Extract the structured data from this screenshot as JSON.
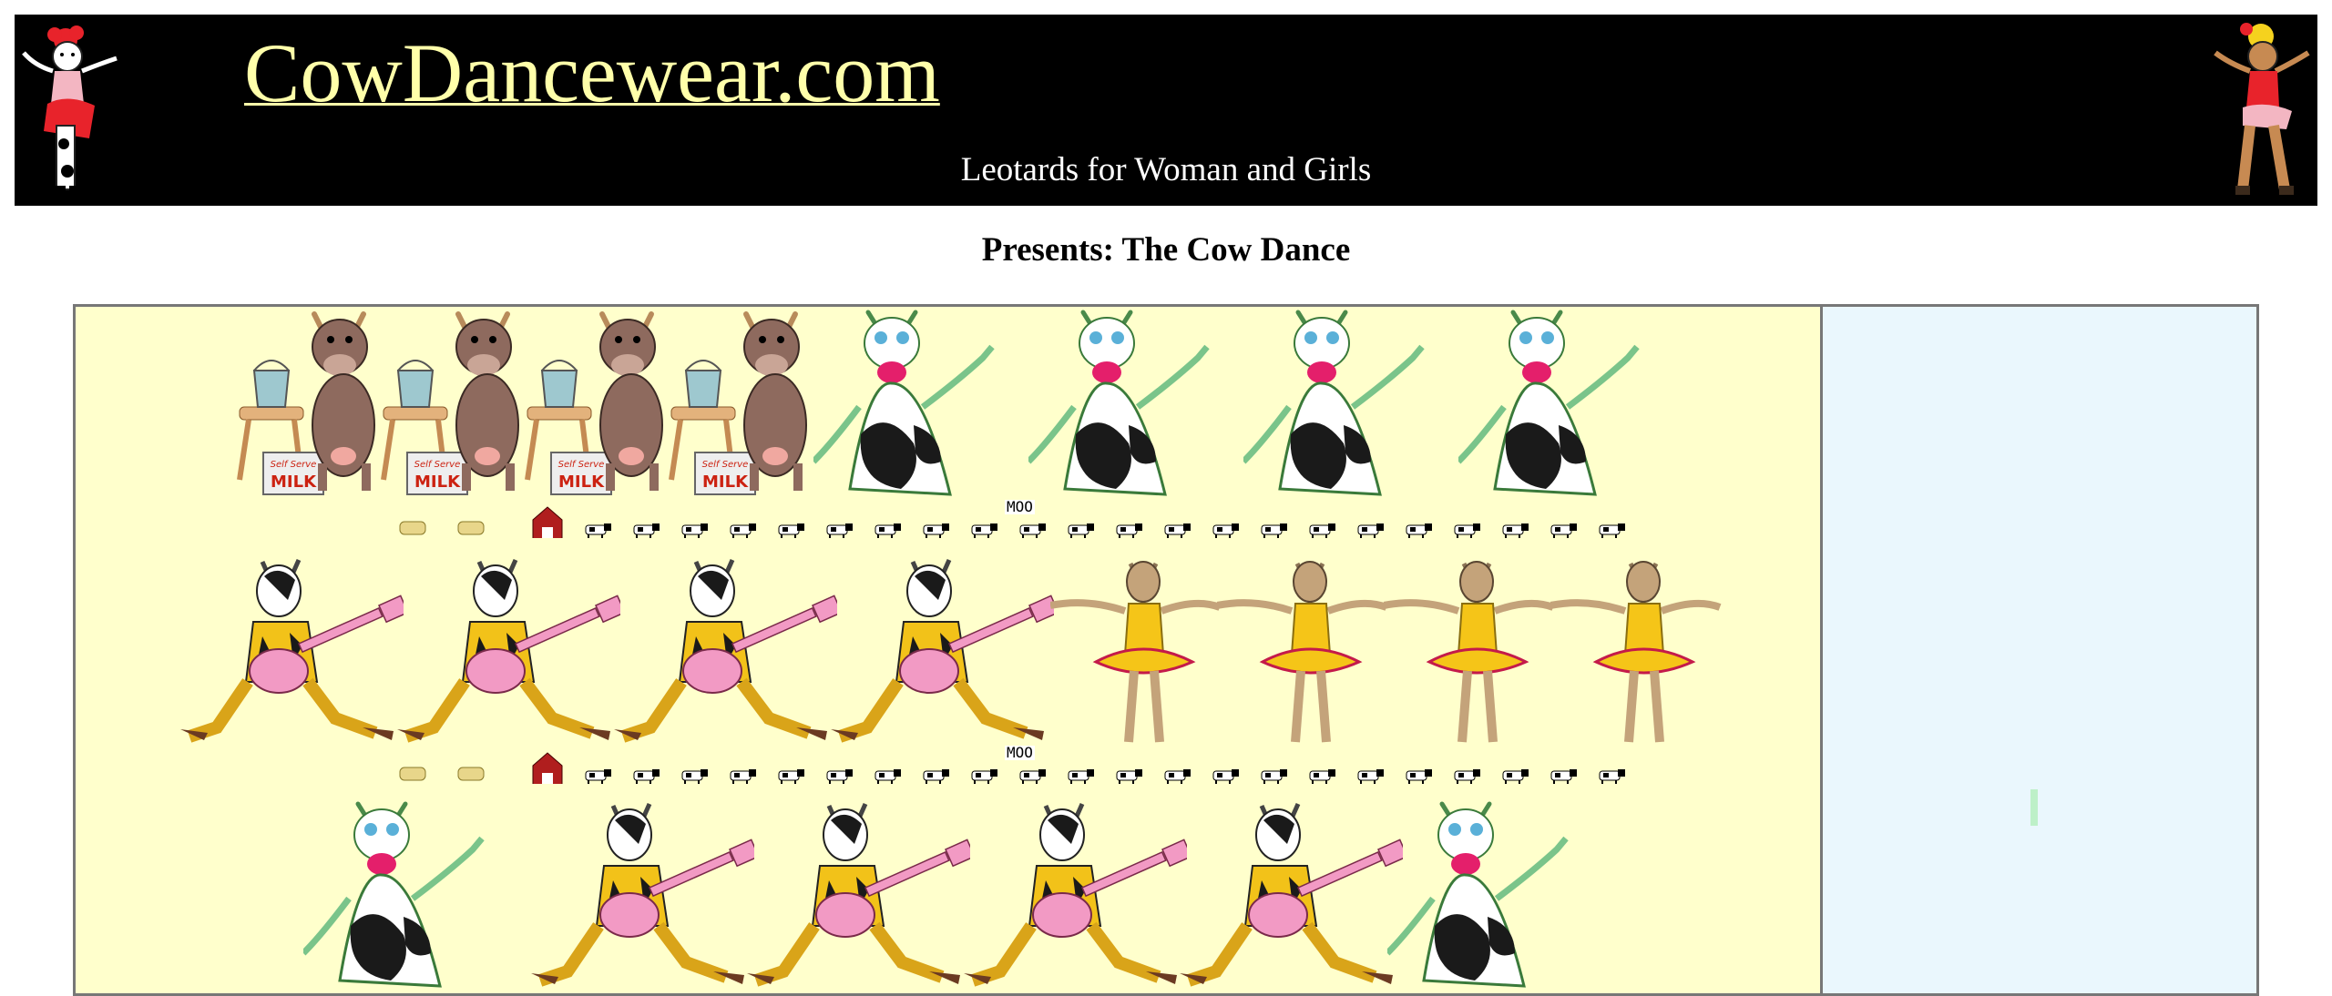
{
  "header": {
    "title": "CowDancewear.com",
    "tagline": "Leotards for Woman and Girls",
    "background": "#000000",
    "title_color": "#ffffaa"
  },
  "page": {
    "heading": "Presents: The Cow Dance"
  },
  "stage": {
    "main_background": "#ffffcc",
    "side_background": "#eaf7fd",
    "rows": [
      {
        "characters": [
          "milk-cow",
          "milk-cow",
          "milk-cow",
          "milk-cow",
          "dancing-cow",
          "dancing-cow",
          "dancing-cow",
          "dancing-cow"
        ]
      },
      {
        "characters": [
          "guitar-cow",
          "guitar-cow",
          "guitar-cow",
          "guitar-cow",
          "ballerina-cow",
          "ballerina-cow",
          "ballerina-cow",
          "ballerina-cow"
        ]
      },
      {
        "characters": [
          "dancing-cow",
          "guitar-cow",
          "guitar-cow",
          "guitar-cow",
          "guitar-cow",
          "dancing-cow"
        ]
      }
    ],
    "farm_banner": {
      "moo_text": "MOO",
      "milk_label": "MILK",
      "milk_brand": "Self Serve"
    }
  }
}
